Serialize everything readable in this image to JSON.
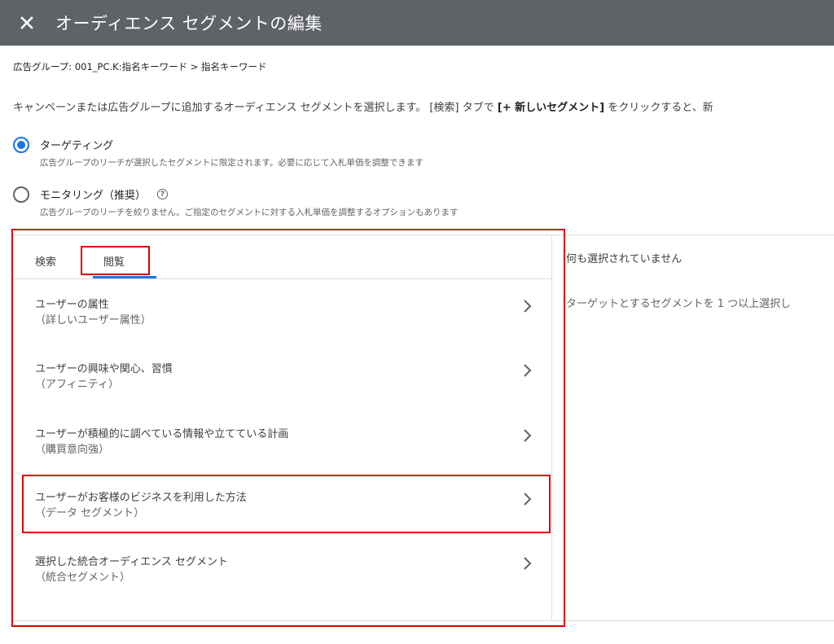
{
  "header": {
    "title": "オーディエンス セグメントの編集",
    "close_icon": "close-icon"
  },
  "breadcrumb": "広告グループ: 001_PC.K:指名キーワード > 指名キーワード",
  "description": {
    "part1": "キャンペーンまたは広告グループに追加するオーディエンス セグメントを選択します。 [検索] タブで ",
    "bold": "[+ 新しいセグメント]",
    "part2": " をクリックすると、新"
  },
  "options": [
    {
      "label": "ターゲティング",
      "sub": "広告グループのリーチが選択したセグメントに限定されます。必要に応じて入札単価を調整できます",
      "selected": true
    },
    {
      "label": "モニタリング（推奨）",
      "sub": "広告グループのリーチを絞りません。ご指定のセグメントに対する入札単価を調整するオプションもあります",
      "selected": false
    }
  ],
  "tabs": [
    {
      "label": "検索",
      "active": false
    },
    {
      "label": "閲覧",
      "active": true
    }
  ],
  "categories": [
    {
      "title": "ユーザーの属性",
      "sub": "（詳しいユーザー属性）"
    },
    {
      "title": "ユーザーの興味や関心、習慣",
      "sub": "（アフィニティ）"
    },
    {
      "title": "ユーザーが積極的に調べている情報や立てている計画",
      "sub": "（購買意向強）"
    },
    {
      "title": "ユーザーがお客様のビジネスを利用した方法",
      "sub": "（データ セグメント）"
    },
    {
      "title": "選択した統合オーディエンス セグメント",
      "sub": "（統合セグメント）"
    }
  ],
  "right_panel": {
    "header": "何も選択されていません",
    "hint": "ターゲットとするセグメントを 1 つ以上選択し"
  },
  "colors": {
    "header_bg": "#5f6368",
    "accent": "#1a73e8",
    "highlight": "#e00000"
  }
}
